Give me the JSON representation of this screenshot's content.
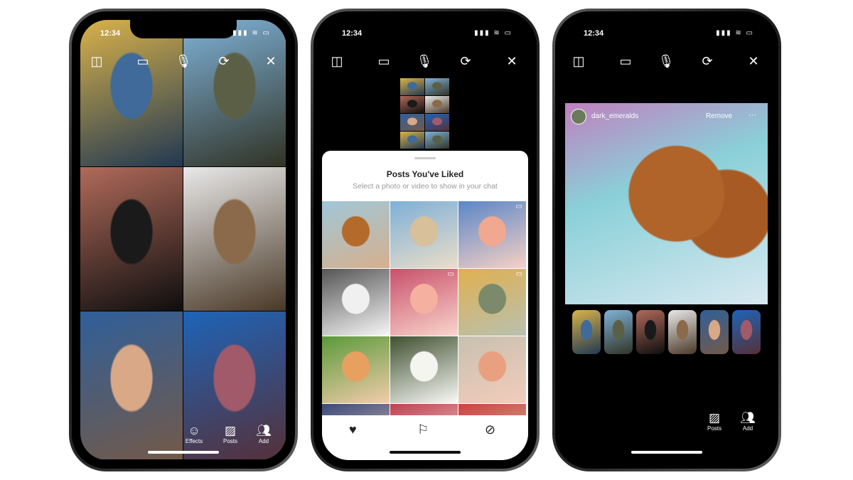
{
  "status": {
    "time": "12:34",
    "signal": "▮▮▮ ≋ ▭"
  },
  "topbar_icons": [
    "layout-icon",
    "video-icon",
    "microphone-icon",
    "flip-camera-icon",
    "close-icon"
  ],
  "phone1": {
    "participants": [
      {
        "colors": [
          "#d9b24a",
          "#3f6a9a"
        ]
      },
      {
        "colors": [
          "#7fb2d8",
          "#5b5f45"
        ]
      },
      {
        "colors": [
          "#b06a5a",
          "#1a1a1a"
        ]
      },
      {
        "colors": [
          "#e9e9e9",
          "#8a6a4a"
        ]
      },
      {
        "colors": [
          "#2f5f9a",
          "#d8a887"
        ]
      },
      {
        "colors": [
          "#1e64b8",
          "#a05a6a"
        ]
      }
    ],
    "buttons": [
      {
        "label": "Effects",
        "icon": "effects-icon"
      },
      {
        "label": "Posts",
        "icon": "image-icon"
      },
      {
        "label": "Add",
        "icon": "add-people-icon"
      }
    ]
  },
  "phone2": {
    "sheet_title": "Posts You've Liked",
    "sheet_subtitle": "Select a photo or video to show in your chat",
    "posts": [
      {
        "colors": [
          "#9fc7d8",
          "#b46a2a"
        ]
      },
      {
        "colors": [
          "#7eb0d8",
          "#d8c09a"
        ]
      },
      {
        "colors": [
          "#5a86c8",
          "#f0a890"
        ],
        "video": true
      },
      {
        "colors": [
          "#555",
          "#f0f0f0"
        ]
      },
      {
        "colors": [
          "#c8506a",
          "#f5b0a0"
        ],
        "video": true
      },
      {
        "colors": [
          "#e0b050",
          "#7a8a6a"
        ],
        "video": true
      },
      {
        "colors": [
          "#5a9a3a",
          "#e8a060"
        ]
      },
      {
        "colors": [
          "#405030",
          "#f5f5f0"
        ]
      },
      {
        "colors": [
          "#c8c0b0",
          "#e8a080"
        ]
      },
      {
        "colors": [
          "#3a4a7a",
          "#e0a080"
        ]
      },
      {
        "colors": [
          "#c04050",
          "#e8e0d0"
        ]
      },
      {
        "colors": [
          "#d04040",
          "#90b060"
        ]
      }
    ],
    "nav": [
      "heart-icon",
      "bookmark-icon",
      "compass-icon"
    ]
  },
  "phone3": {
    "post_username": "dark_emeralds",
    "remove_label": "Remove",
    "more_label": "···",
    "thumbs": [
      {
        "colors": [
          "#d9b24a",
          "#3f6a9a"
        ]
      },
      {
        "colors": [
          "#7fb2d8",
          "#5b5f45"
        ]
      },
      {
        "colors": [
          "#b06a5a",
          "#1a1a1a"
        ]
      },
      {
        "colors": [
          "#e9e9e9",
          "#8a6a4a"
        ]
      },
      {
        "colors": [
          "#2f5f9a",
          "#d8a887"
        ]
      },
      {
        "colors": [
          "#1e64b8",
          "#a05a6a"
        ]
      }
    ],
    "buttons": [
      {
        "label": "Posts",
        "icon": "image-icon"
      },
      {
        "label": "Add",
        "icon": "add-people-icon"
      }
    ]
  }
}
